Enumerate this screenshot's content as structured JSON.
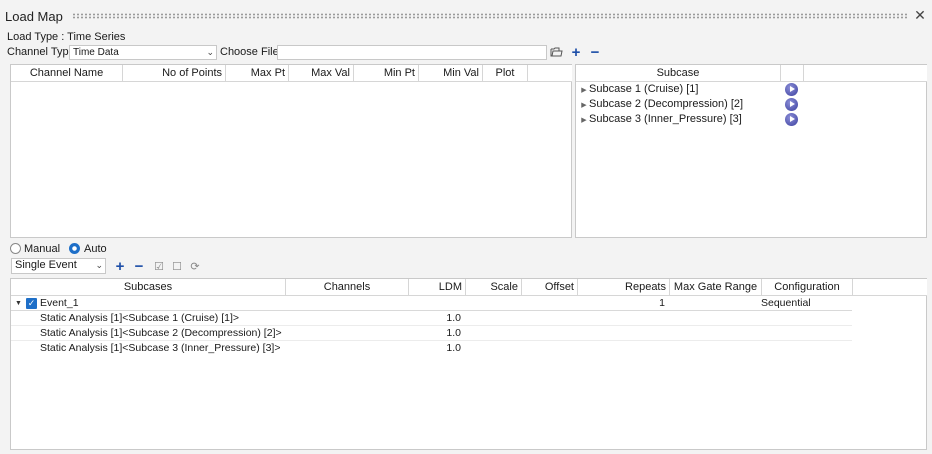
{
  "window": {
    "title": "Load Map"
  },
  "load_type": "Load Type : Time Series",
  "channel_type": {
    "label": "Channel Type",
    "value": "Time Data"
  },
  "choose_file": {
    "label": "Choose File",
    "value": ""
  },
  "channel_table": {
    "columns": [
      "Channel Name",
      "No of Points",
      "Max Pt",
      "Max Val",
      "Min Pt",
      "Min Val",
      "Plot"
    ]
  },
  "subcase_panel": {
    "header": "Subcase",
    "items": [
      "Subcase 1 (Cruise) [1]",
      "Subcase 2 (Decompression) [2]",
      "Subcase 3 (Inner_Pressure) [3]"
    ]
  },
  "mode": {
    "manual": "Manual",
    "auto": "Auto",
    "selected": "Auto"
  },
  "event_type": {
    "value": "Single Event"
  },
  "event_table": {
    "columns": [
      "Subcases",
      "Channels",
      "LDM",
      "Scale",
      "Offset",
      "Repeats",
      "Max Gate Range",
      "Configuration"
    ],
    "event": {
      "name": "Event_1",
      "repeats": "1",
      "configuration": "Sequential"
    },
    "rows": [
      {
        "subcase": "Static Analysis [1]<Subcase 1 (Cruise) [1]>",
        "ldm": "1.0"
      },
      {
        "subcase": "Static Analysis [1]<Subcase 2 (Decompression) [2]>",
        "ldm": "1.0"
      },
      {
        "subcase": "Static Analysis [1]<Subcase 3 (Inner_Pressure) [3]>",
        "ldm": "1.0"
      }
    ]
  }
}
